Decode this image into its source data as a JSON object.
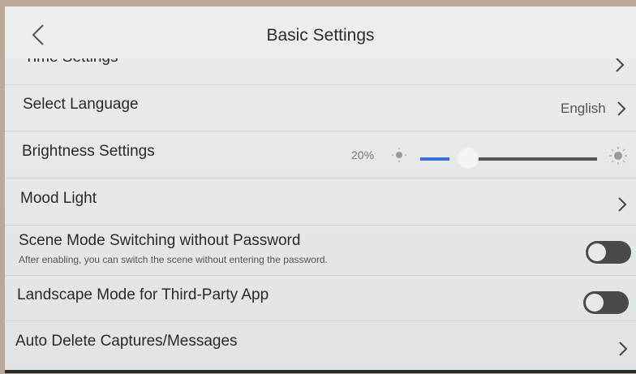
{
  "header": {
    "title": "Basic Settings"
  },
  "rows": {
    "time": {
      "label": "Time Settings"
    },
    "language": {
      "label": "Select Language",
      "value": "English"
    },
    "brightness": {
      "label": "Brightness Settings",
      "percent_label": "20%",
      "level": 0.2
    },
    "mood": {
      "label": "Mood Light"
    },
    "scene": {
      "label": "Scene Mode Switching without Password",
      "description": "After enabling, you can switch the scene without entering the password.",
      "enabled": false
    },
    "landscape": {
      "label": "Landscape Mode for Third-Party App",
      "enabled": false
    },
    "autodelete": {
      "label": "Auto Delete Captures/Messages"
    }
  },
  "colors": {
    "slider_fill": "#3a6fd8",
    "toggle_off": "#4a4a4a"
  }
}
